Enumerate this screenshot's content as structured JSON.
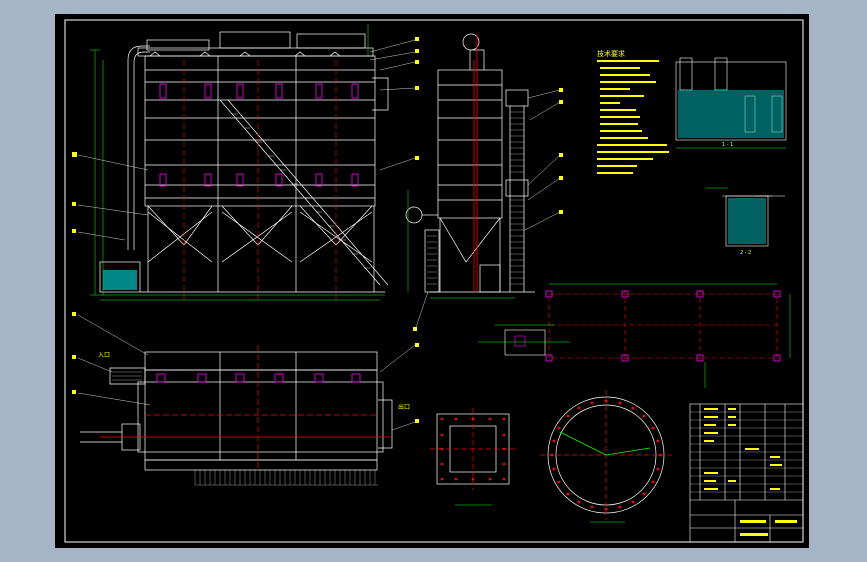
{
  "drawing": {
    "background_color": "#000000",
    "border_color": "#ffffff",
    "colors": {
      "structure": "#ffffff",
      "dimension": "#00ff00",
      "centerline": "#ff0000",
      "text": "#ffff00",
      "water": "#00ffff",
      "component": "#ff00ff"
    }
  },
  "notes": {
    "title": "技术要求",
    "lines": []
  },
  "views": {
    "section_label_1": "1 - 1",
    "section_label_2": "2 - 2",
    "inlet_label": "入口",
    "outlet_label": "出口"
  },
  "title_block": {
    "visible": true
  }
}
